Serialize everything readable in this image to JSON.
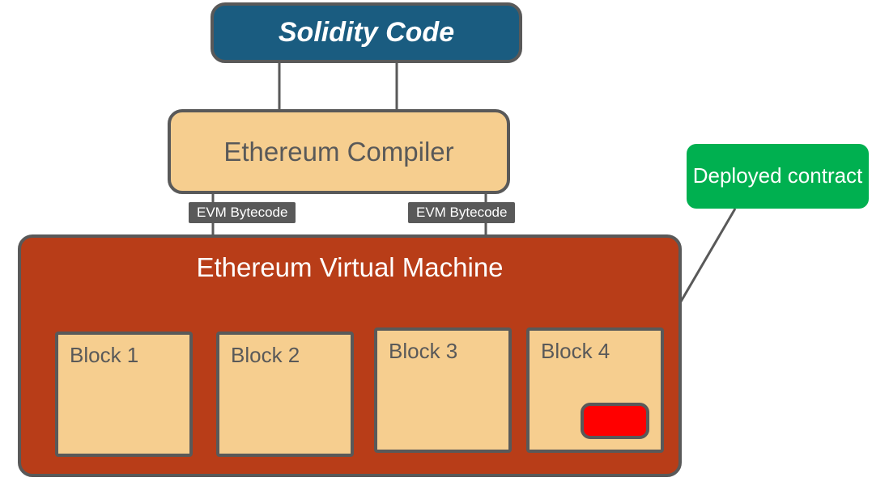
{
  "diagram": {
    "solidity": "Solidity Code",
    "compiler": "Ethereum Compiler",
    "evm": "Ethereum Virtual Machine",
    "bytecode1": "EVM Bytecode",
    "bytecode2": "EVM Bytecode",
    "block1": "Block 1",
    "block2": "Block 2",
    "block3": "Block 3",
    "block4": "Block 4",
    "deployed": "Deployed contract"
  }
}
